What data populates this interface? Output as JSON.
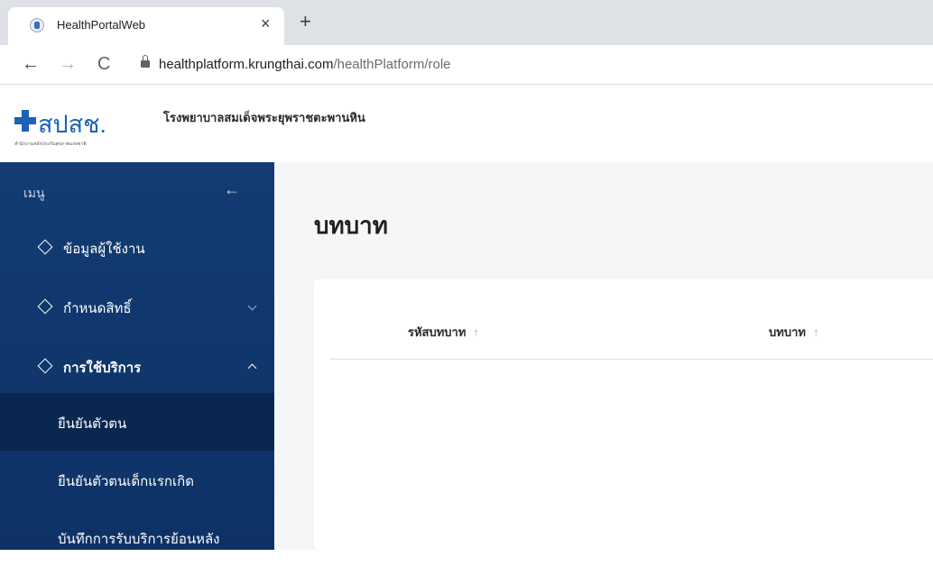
{
  "browser": {
    "tab_title": "HealthPortalWeb",
    "close_symbol": "×",
    "newtab_symbol": "+",
    "url_host": "healthplatform.krungthai.com",
    "url_path": "/healthPlatform/role"
  },
  "header": {
    "logo_text": "สปสช.",
    "logo_subtitle": "สำนักงานหลักประกันสุขภาพแห่งชาติ",
    "hospital_name": "โรงพยาบาลสมเด็จพระยุพราชตะพานหิน"
  },
  "sidebar": {
    "menu_label": "เมนู",
    "items": [
      {
        "label": "ข้อมูลผู้ใช้งาน"
      },
      {
        "label": "กำหนดสิทธิ์"
      },
      {
        "label": "การใช้บริการ"
      }
    ],
    "subitems": [
      {
        "label": "ยืนยันตัวตน",
        "active": true
      },
      {
        "label": "ยืนยันตัวตนเด็กแรกเกิด",
        "active": false
      },
      {
        "label": "บันทึกการรับบริการย้อนหลัง",
        "active": false
      }
    ]
  },
  "main": {
    "page_title": "บทบาท",
    "table": {
      "columns": [
        {
          "label": "รหัสบทบาท",
          "sort_icon": "↑"
        },
        {
          "label": "บทบาท",
          "sort_icon": "↑"
        }
      ]
    }
  }
}
